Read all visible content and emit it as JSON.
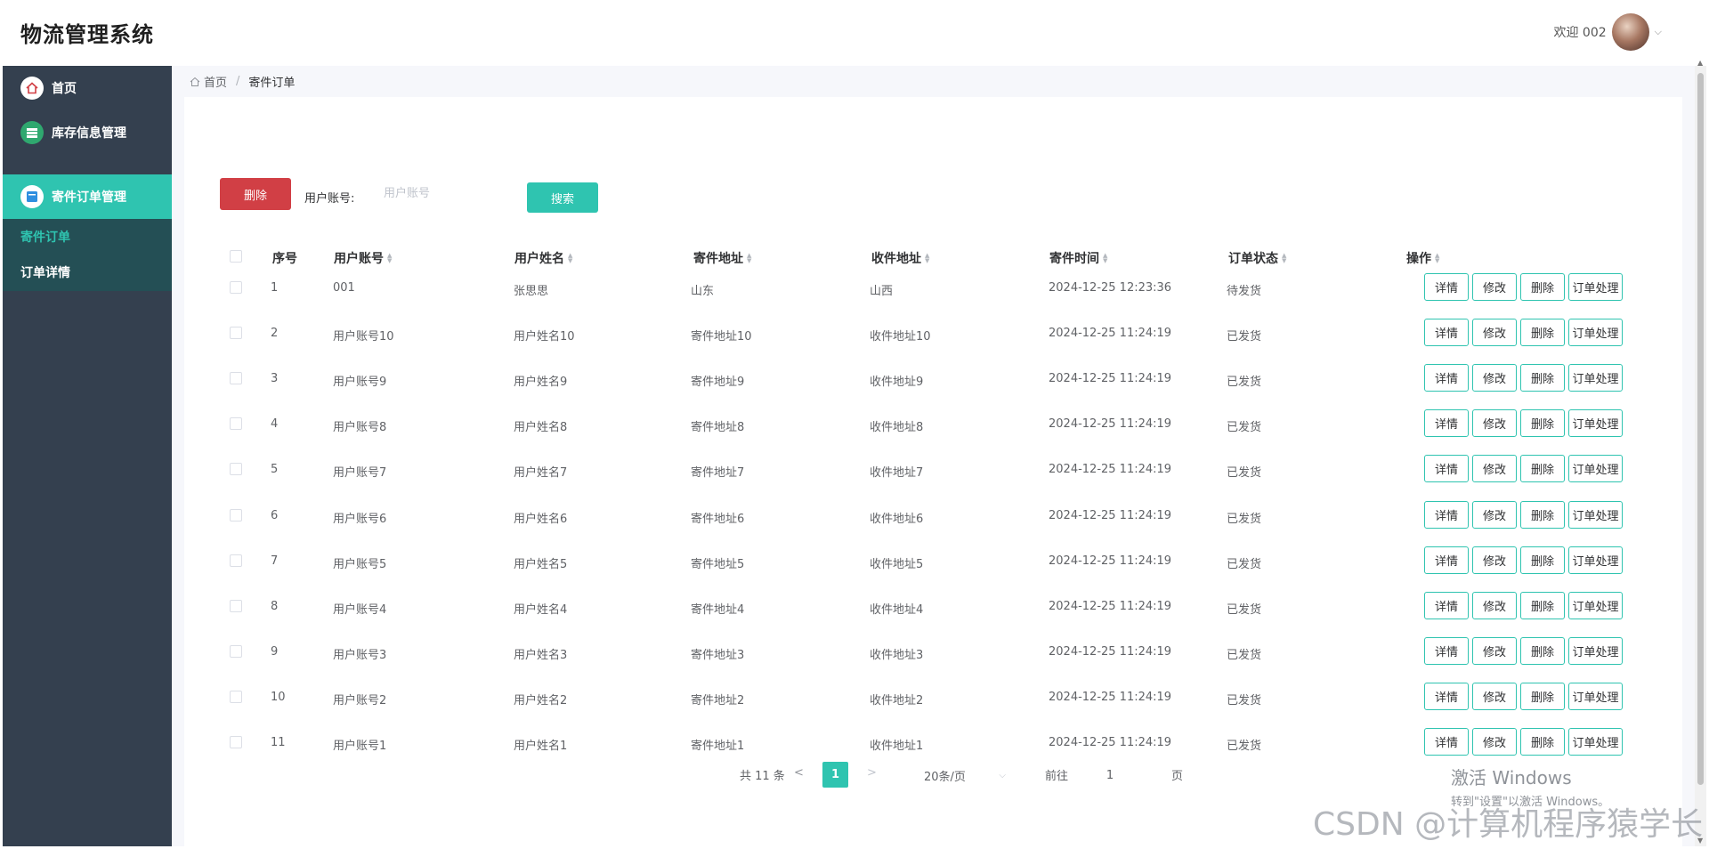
{
  "app": {
    "title": "物流管理系统"
  },
  "header": {
    "welcome": "欢迎 002",
    "caret": "⌵"
  },
  "sidebar": {
    "items": [
      {
        "label": "首页",
        "icon": "home-icon"
      },
      {
        "label": "库存信息管理",
        "icon": "database-icon"
      },
      {
        "label": "寄件订单管理",
        "icon": "document-icon"
      }
    ],
    "subitems": [
      {
        "label": "寄件订单",
        "active": true
      },
      {
        "label": "订单详情",
        "active": false
      }
    ]
  },
  "breadcrumb": {
    "home": "首页",
    "separator": "/",
    "current": "寄件订单"
  },
  "toolbar": {
    "delete_label": "删除",
    "user_account_label": "用户账号:",
    "user_account_placeholder": "用户账号",
    "user_account_value": "",
    "search_label": "搜索"
  },
  "table": {
    "columns": [
      "序号",
      "用户账号",
      "用户姓名",
      "寄件地址",
      "收件地址",
      "寄件时间",
      "订单状态",
      "操作"
    ],
    "actions": [
      "详情",
      "修改",
      "删除",
      "订单处理"
    ],
    "rows": [
      {
        "index": "1",
        "account": "001",
        "name": "张思思",
        "from": "山东",
        "to": "山西",
        "time": "2024-12-25 12:23:36",
        "status": "待发货"
      },
      {
        "index": "2",
        "account": "用户账号10",
        "name": "用户姓名10",
        "from": "寄件地址10",
        "to": "收件地址10",
        "time": "2024-12-25 11:24:19",
        "status": "已发货"
      },
      {
        "index": "3",
        "account": "用户账号9",
        "name": "用户姓名9",
        "from": "寄件地址9",
        "to": "收件地址9",
        "time": "2024-12-25 11:24:19",
        "status": "已发货"
      },
      {
        "index": "4",
        "account": "用户账号8",
        "name": "用户姓名8",
        "from": "寄件地址8",
        "to": "收件地址8",
        "time": "2024-12-25 11:24:19",
        "status": "已发货"
      },
      {
        "index": "5",
        "account": "用户账号7",
        "name": "用户姓名7",
        "from": "寄件地址7",
        "to": "收件地址7",
        "time": "2024-12-25 11:24:19",
        "status": "已发货"
      },
      {
        "index": "6",
        "account": "用户账号6",
        "name": "用户姓名6",
        "from": "寄件地址6",
        "to": "收件地址6",
        "time": "2024-12-25 11:24:19",
        "status": "已发货"
      },
      {
        "index": "7",
        "account": "用户账号5",
        "name": "用户姓名5",
        "from": "寄件地址5",
        "to": "收件地址5",
        "time": "2024-12-25 11:24:19",
        "status": "已发货"
      },
      {
        "index": "8",
        "account": "用户账号4",
        "name": "用户姓名4",
        "from": "寄件地址4",
        "to": "收件地址4",
        "time": "2024-12-25 11:24:19",
        "status": "已发货"
      },
      {
        "index": "9",
        "account": "用户账号3",
        "name": "用户姓名3",
        "from": "寄件地址3",
        "to": "收件地址3",
        "time": "2024-12-25 11:24:19",
        "status": "已发货"
      },
      {
        "index": "10",
        "account": "用户账号2",
        "name": "用户姓名2",
        "from": "寄件地址2",
        "to": "收件地址2",
        "time": "2024-12-25 11:24:19",
        "status": "已发货"
      },
      {
        "index": "11",
        "account": "用户账号1",
        "name": "用户姓名1",
        "from": "寄件地址1",
        "to": "收件地址1",
        "time": "2024-12-25 11:24:19",
        "status": "已发货"
      }
    ]
  },
  "pagination": {
    "total": "共 11 条",
    "prev": "<",
    "current_page": "1",
    "next": ">",
    "page_size": "20条/页",
    "goto_label": "前往",
    "goto_value": "1",
    "page_suffix": "页"
  },
  "watermarks": {
    "windows_line1": "激活 Windows",
    "windows_line2": "转到\"设置\"以激活 Windows。",
    "csdn": "CSDN @计算机程序猿学长"
  },
  "colors": {
    "accent": "#2fc4b0",
    "danger": "#d13f45",
    "sidebar": "#34404f",
    "submenu": "#244f55"
  }
}
